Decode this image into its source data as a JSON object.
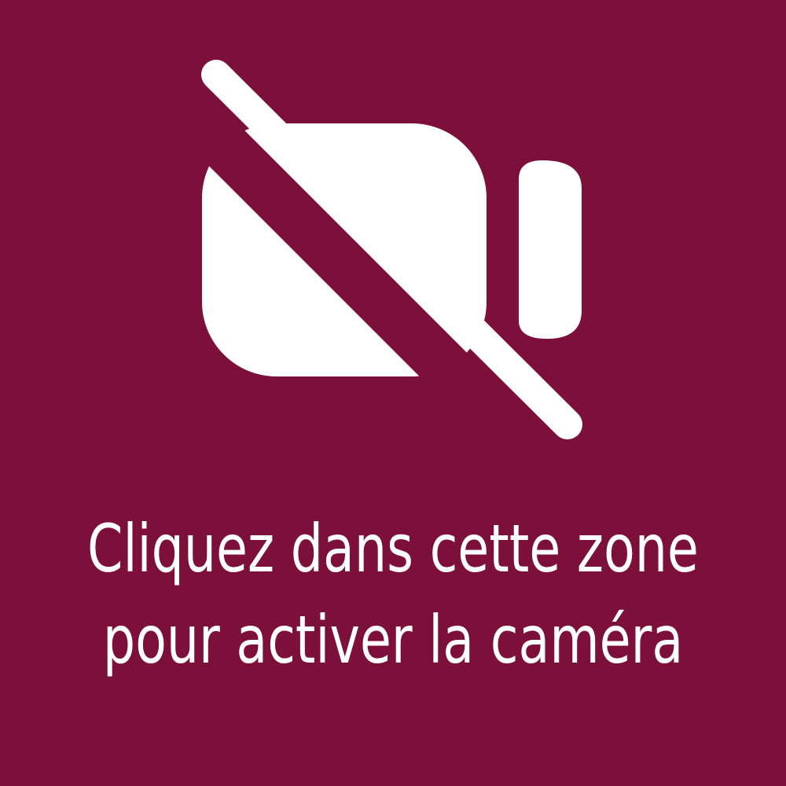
{
  "colors": {
    "background": "#7c103a",
    "foreground": "#ffffff"
  },
  "icon": "video-camera-off-icon",
  "prompt": {
    "line1": "Cliquez dans cette zone",
    "line2": "pour activer la caméra"
  }
}
